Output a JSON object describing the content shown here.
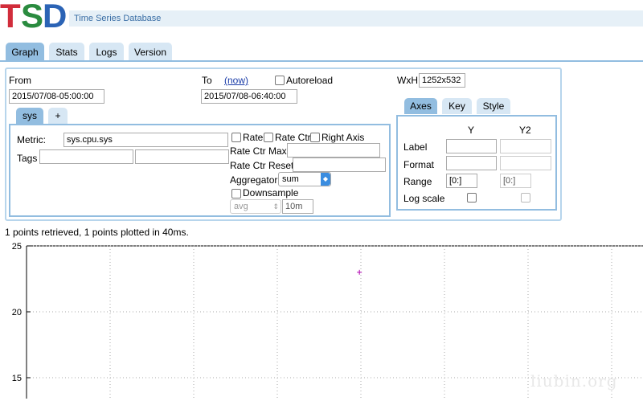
{
  "header": {
    "logo_letters": [
      {
        "char": "T",
        "color": "#d12d3b"
      },
      {
        "char": "S",
        "color": "#2a8b3f"
      },
      {
        "char": "D",
        "color": "#2b63b5"
      }
    ],
    "subtitle": "Time Series Database"
  },
  "tabs": [
    {
      "label": "Graph",
      "active": true
    },
    {
      "label": "Stats",
      "active": false
    },
    {
      "label": "Logs",
      "active": false
    },
    {
      "label": "Version",
      "active": false
    }
  ],
  "query": {
    "from_label": "From",
    "from_value": "2015/07/08-05:00:00",
    "to_label": "To",
    "now_link": "(now)",
    "to_value": "2015/07/08-06:40:00",
    "autoreload_label": "Autoreload",
    "wxh_label": "WxH:",
    "wxh_value": "1252x532",
    "metric_tabs": [
      "sys",
      "+"
    ],
    "metric_label": "Metric:",
    "metric_value": "sys.cpu.sys",
    "tags_label": "Tags",
    "rate_label": "Rate",
    "rate_ctr_label": "Rate Ctr",
    "right_axis_label": "Right Axis",
    "rate_ctr_max_label": "Rate Ctr Max:",
    "rate_ctr_reset_label": "Rate Ctr Reset:",
    "aggregator_label": "Aggregator:",
    "aggregator_value": "sum",
    "downsample_label": "Downsample",
    "downsample_func": "avg",
    "downsample_interval": "10m"
  },
  "options": {
    "tabs": [
      "Axes",
      "Key",
      "Style"
    ],
    "col_y": "Y",
    "col_y2": "Y2",
    "label_row": "Label",
    "format_row": "Format",
    "range_row": "Range",
    "range_y": "[0:]",
    "range_y2": "[0:]",
    "logscale_row": "Log scale"
  },
  "status_text": "1 points retrieved, 1 points plotted in 40ms.",
  "chart_data": {
    "type": "scatter",
    "y_ticks": [
      "25",
      "20",
      "15"
    ],
    "ylim_visible": [
      14,
      25
    ],
    "points": [
      {
        "x_fraction_of_visible_axis": 0.54,
        "y": 23.0
      }
    ],
    "marker_color": "#b000b0",
    "grid": "dotted"
  },
  "watermark": "liubin.org"
}
